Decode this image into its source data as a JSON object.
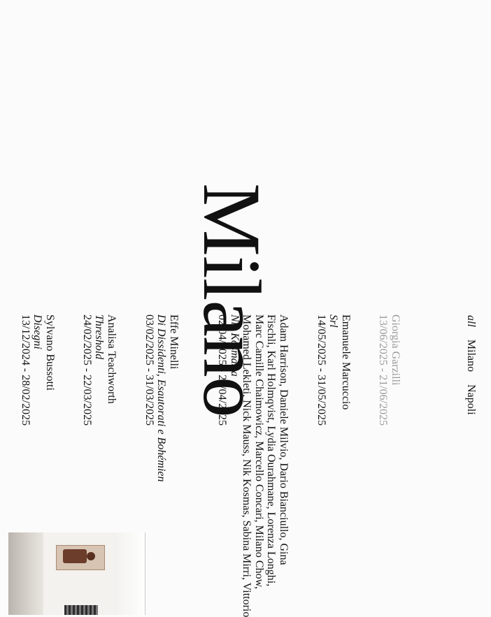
{
  "nav": {
    "items": [
      {
        "label": "all",
        "active": true
      },
      {
        "label": "Milano",
        "active": false
      },
      {
        "label": "Napoli",
        "active": false
      }
    ]
  },
  "page_title": "Milano",
  "exhibitions": [
    {
      "artist": "Giorgia Garzilli",
      "subtitle": "",
      "dates": "13/06/2025 - 21/06/2025",
      "dimmed": true
    },
    {
      "artist": "Emanuele Marcuccio",
      "subtitle": "Srl",
      "dates": "14/05/2025 - 31/05/2025",
      "dimmed": false
    },
    {
      "artist": "Adam Harrison, Daniele Milvio, Dario Bianciullo, Gina",
      "artist_lines": [
        "Adam Harrison, Daniele Milvio, Dario Bianciullo, Gina",
        "Fischli, Karl Holmqvist, Lydia Ourahmane, Lorenza Longhi,",
        "Marc Camille Chaimowicz, Marcello Concari, Milano Chow,",
        "Mohamed Lekleti, Nick Mauss, Nik Kosmas, Sabina Mirri, Vittorio"
      ],
      "subtitle": "Nik Kosmas a",
      "dates": "02/04/2025 - 24/04/2025",
      "dimmed": false
    },
    {
      "artist": "Effe Minelli",
      "subtitle": "Di Dissidenti, Esautorati e Bohémien",
      "dates": "03/02/2025 - 31/03/2025",
      "dimmed": false
    },
    {
      "artist": "Analisa Teachworth",
      "subtitle": "Threshold",
      "dates": "24/02/2025 - 22/03/2025",
      "dimmed": false
    },
    {
      "artist": "Sylvano Bussotti",
      "subtitle": "Disegni",
      "dates": "13/12/2024 - 28/02/2025",
      "dimmed": false
    }
  ],
  "colors": {
    "background": "#fbfbfb",
    "text": "#111111",
    "dimmed_text": "#9a9a9a"
  }
}
